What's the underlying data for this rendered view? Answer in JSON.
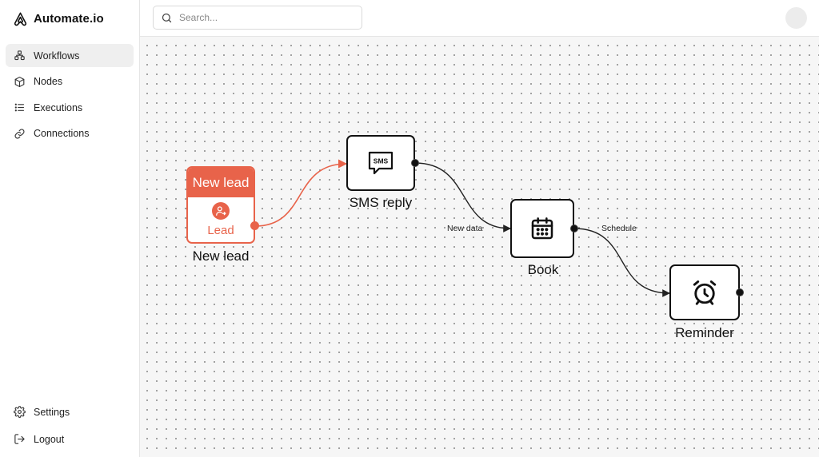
{
  "app": {
    "name": "Automate.io"
  },
  "sidebar": {
    "items": [
      {
        "label": "Workflows",
        "icon": "workflow-icon",
        "active": true
      },
      {
        "label": "Nodes",
        "icon": "cube-icon"
      },
      {
        "label": "Executions",
        "icon": "list-icon"
      },
      {
        "label": "Connections",
        "icon": "link-icon"
      }
    ],
    "bottom": [
      {
        "label": "Settings",
        "icon": "gear-icon"
      },
      {
        "label": "Logout",
        "icon": "logout-icon"
      }
    ]
  },
  "search": {
    "placeholder": "Search..."
  },
  "workflow": {
    "nodes": {
      "lead": {
        "header": "New lead",
        "badge": "Lead",
        "title": "New lead",
        "icon": "user-arrow-icon",
        "color": "#e8634a"
      },
      "sms": {
        "title": "SMS reply",
        "icon": "sms-icon",
        "icon_text": "SMS"
      },
      "book": {
        "title": "Book",
        "icon": "calendar-icon"
      },
      "reminder": {
        "title": "Reminder",
        "icon": "alarm-clock-icon"
      }
    },
    "edges": {
      "sms_book": {
        "label": "New data"
      },
      "book_reminder": {
        "label": "Schedule"
      }
    }
  }
}
